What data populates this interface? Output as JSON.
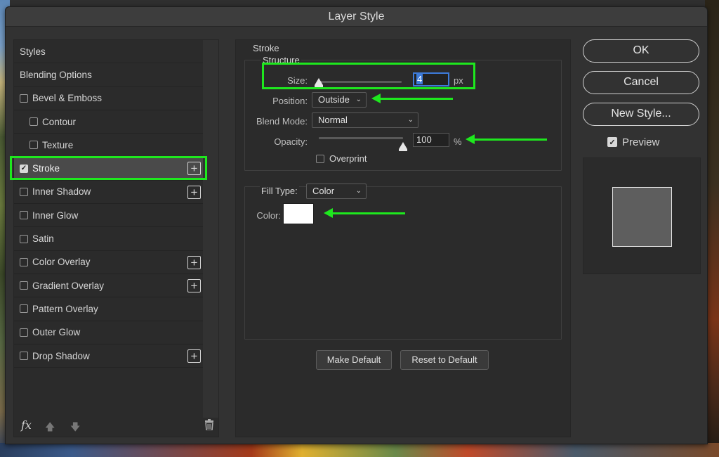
{
  "window": {
    "title": "Layer Style"
  },
  "styles_list": [
    {
      "label": "Styles",
      "type": "heading"
    },
    {
      "label": "Blending Options",
      "type": "heading"
    },
    {
      "label": "Bevel & Emboss",
      "type": "check",
      "checked": false
    },
    {
      "label": "Contour",
      "type": "sub",
      "checked": false
    },
    {
      "label": "Texture",
      "type": "sub",
      "checked": false
    },
    {
      "label": "Stroke",
      "type": "check",
      "checked": true,
      "plus": true,
      "selected": true
    },
    {
      "label": "Inner Shadow",
      "type": "check",
      "checked": false,
      "plus": true
    },
    {
      "label": "Inner Glow",
      "type": "check",
      "checked": false
    },
    {
      "label": "Satin",
      "type": "check",
      "checked": false
    },
    {
      "label": "Color Overlay",
      "type": "check",
      "checked": false,
      "plus": true
    },
    {
      "label": "Gradient Overlay",
      "type": "check",
      "checked": false,
      "plus": true
    },
    {
      "label": "Pattern Overlay",
      "type": "check",
      "checked": false
    },
    {
      "label": "Outer Glow",
      "type": "check",
      "checked": false
    },
    {
      "label": "Drop Shadow",
      "type": "check",
      "checked": false,
      "plus": true
    }
  ],
  "footer": {
    "fx": "fx",
    "up_icon": "arrow-up-icon",
    "down_icon": "arrow-down-icon",
    "trash_icon": "trash-icon"
  },
  "stroke": {
    "section": "Stroke",
    "structure": "Structure",
    "size_label": "Size:",
    "size_value": "4",
    "size_unit": "px",
    "position_label": "Position:",
    "position_value": "Outside",
    "blend_label": "Blend Mode:",
    "blend_value": "Normal",
    "opacity_label": "Opacity:",
    "opacity_value": "100",
    "opacity_unit": "%",
    "overprint_label": "Overprint",
    "overprint_checked": false,
    "filltype_label": "Fill Type:",
    "filltype_value": "Color",
    "color_label": "Color:",
    "color_value": "#ffffff",
    "make_default": "Make Default",
    "reset_default": "Reset to Default"
  },
  "actions": {
    "ok": "OK",
    "cancel": "Cancel",
    "new_style": "New Style...",
    "preview_label": "Preview",
    "preview_checked": true
  },
  "colors": {
    "highlight": "#1ee81e",
    "dialog_bg": "#323232",
    "panel_bg": "#2b2b2b",
    "focus_blue": "#3d7bd9"
  }
}
